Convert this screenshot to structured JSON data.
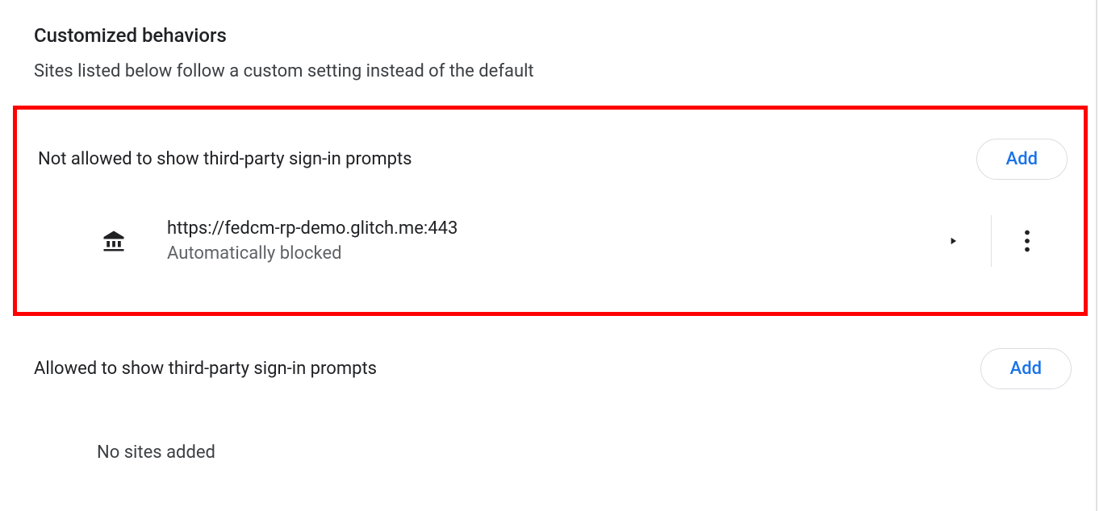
{
  "header": {
    "title": "Customized behaviors",
    "description": "Sites listed below follow a custom setting instead of the default"
  },
  "notAllowed": {
    "title": "Not allowed to show third-party sign-in prompts",
    "addLabel": "Add",
    "sites": [
      {
        "url": "https://fedcm-rp-demo.glitch.me:443",
        "status": "Automatically blocked"
      }
    ]
  },
  "allowed": {
    "title": "Allowed to show third-party sign-in prompts",
    "addLabel": "Add",
    "emptyText": "No sites added"
  }
}
